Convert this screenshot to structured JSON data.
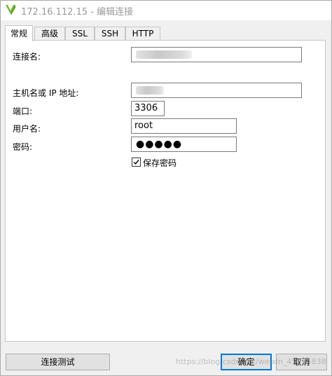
{
  "window": {
    "title": "172.16.112.15 - 编辑连接",
    "logo_icon": "navicat-logo-icon",
    "accent_color": "#0078d7"
  },
  "tabs": [
    {
      "label": "常规",
      "active": true
    },
    {
      "label": "高级",
      "active": false
    },
    {
      "label": "SSL",
      "active": false
    },
    {
      "label": "SSH",
      "active": false
    },
    {
      "label": "HTTP",
      "active": false
    }
  ],
  "form": {
    "connection_name": {
      "label": "连接名:",
      "value": ""
    },
    "host": {
      "label": "主机名或 IP 地址:",
      "value": ""
    },
    "port": {
      "label": "端口:",
      "value": "3306"
    },
    "username": {
      "label": "用户名:",
      "value": "root"
    },
    "password": {
      "label": "密码:",
      "masked": "●●●●●"
    },
    "save_password": {
      "label": "保存密码",
      "checked": true
    }
  },
  "buttons": {
    "test": "连接测试",
    "ok": "确定",
    "cancel": "取消"
  },
  "watermark": "https://blog.csdn.net/weixin_45234838"
}
